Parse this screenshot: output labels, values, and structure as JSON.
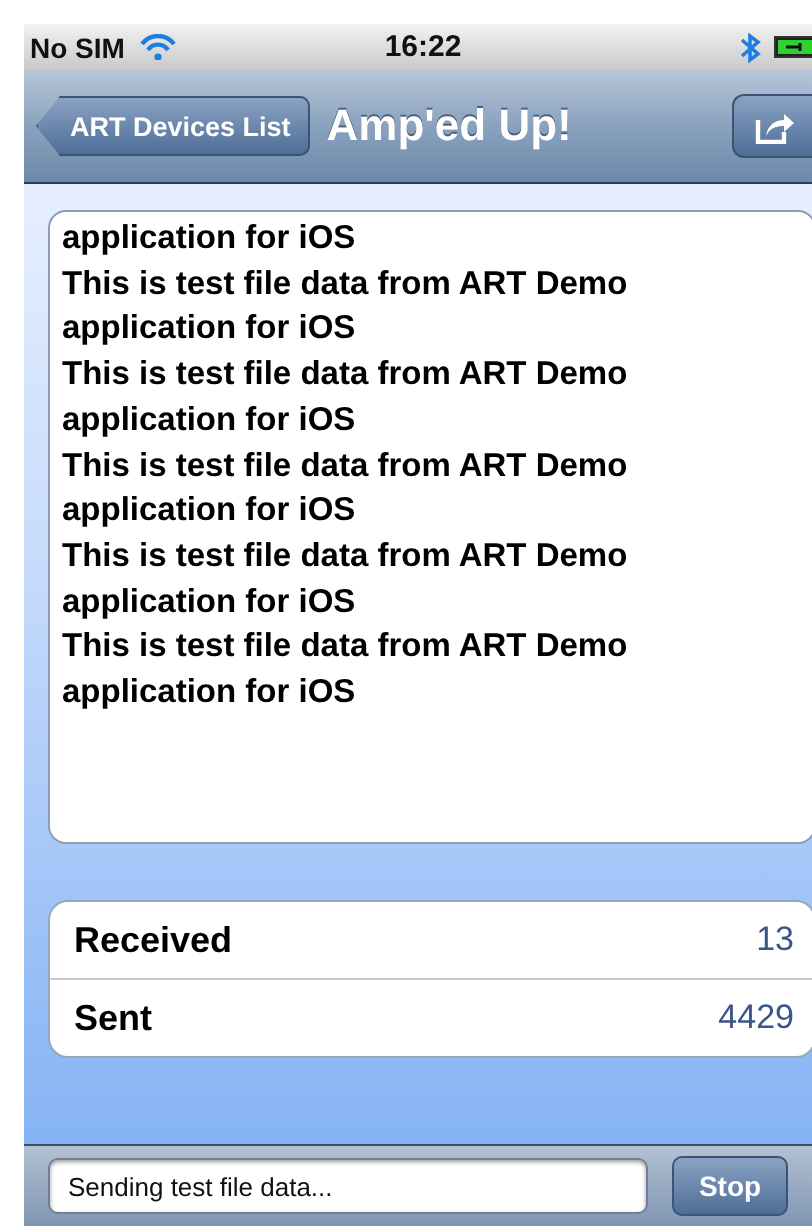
{
  "status_bar": {
    "carrier": "No SIM",
    "time": "16:22"
  },
  "nav_bar": {
    "back_button": "ART Devices List",
    "title": "Amp'ed Up!"
  },
  "log_text": "application for iOS\nThis is test file data from ART Demo\napplication for iOS\nThis is test file data from ART Demo\napplication for iOS\nThis is test file data from ART Demo\napplication for iOS\nThis is test file data from ART Demo\napplication for iOS\nThis is test file data from ART Demo\napplication for iOS",
  "stats": [
    {
      "label": "Received",
      "value": "13"
    },
    {
      "label": "Sent",
      "value": "4429"
    }
  ],
  "toolbar": {
    "status_field": "Sending test file data...",
    "button": "Stop"
  }
}
